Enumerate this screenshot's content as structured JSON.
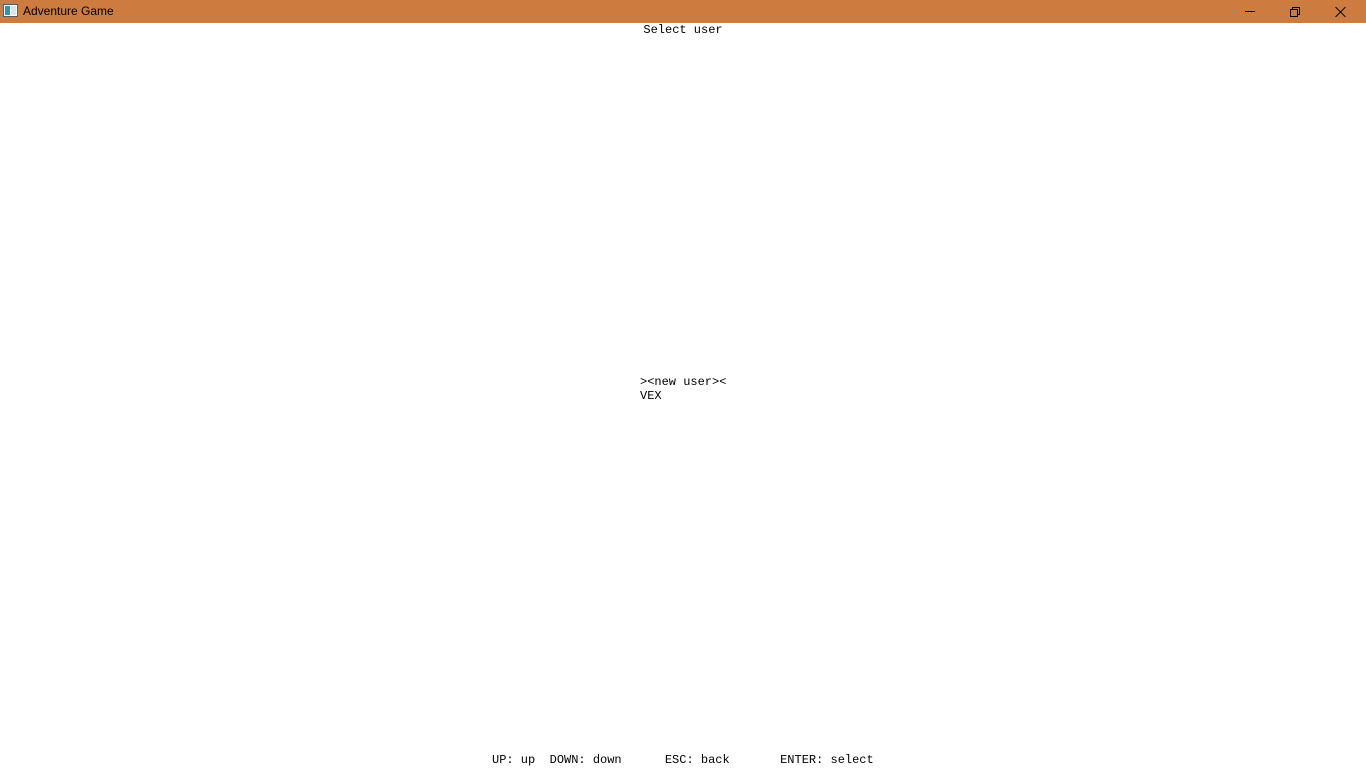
{
  "window": {
    "title": "Adventure Game",
    "icon": "app-window-icon",
    "titlebar_color": "#cd7b3e",
    "controls": {
      "minimize_icon": "minimize-icon",
      "maximize_icon": "restore-icon",
      "close_icon": "close-icon"
    }
  },
  "screen": {
    "title": "Select user",
    "users": [
      {
        "label": "><new user><",
        "selected": true
      },
      {
        "label": "VEX",
        "selected": false
      }
    ],
    "help": [
      "UP: up",
      "DOWN: down",
      "ESC: back",
      "ENTER: select"
    ]
  }
}
